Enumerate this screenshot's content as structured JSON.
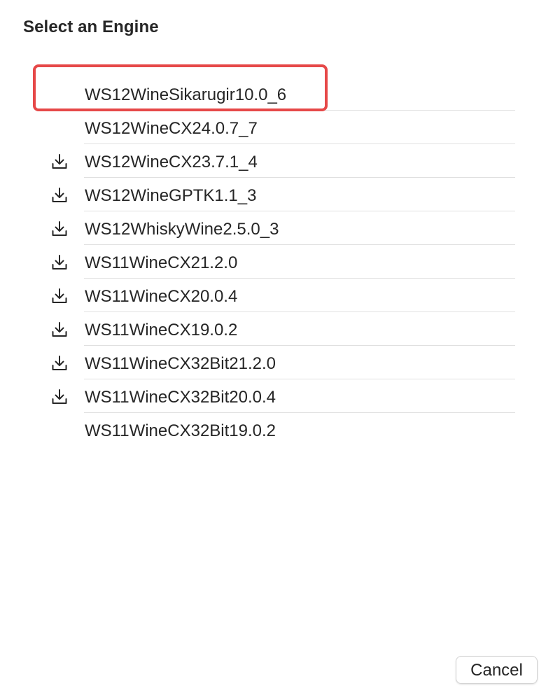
{
  "dialog": {
    "title": "Select an Engine"
  },
  "engines": [
    {
      "name": "WS12WineSikarugir10.0_6",
      "icon": "none"
    },
    {
      "name": "WS12WineCX24.0.7_7",
      "icon": "none"
    },
    {
      "name": "WS12WineCX23.7.1_4",
      "icon": "download-icon"
    },
    {
      "name": "WS12WineGPTK1.1_3",
      "icon": "download-icon"
    },
    {
      "name": "WS12WhiskyWine2.5.0_3",
      "icon": "download-icon"
    },
    {
      "name": "WS11WineCX21.2.0",
      "icon": "download-icon"
    },
    {
      "name": "WS11WineCX20.0.4",
      "icon": "download-icon"
    },
    {
      "name": "WS11WineCX19.0.2",
      "icon": "download-icon"
    },
    {
      "name": "WS11WineCX32Bit21.2.0",
      "icon": "download-icon"
    },
    {
      "name": "WS11WineCX32Bit20.0.4",
      "icon": "download-icon"
    },
    {
      "name": "WS11WineCX32Bit19.0.2",
      "icon": "none"
    }
  ],
  "buttons": {
    "cancel_label": "Cancel"
  },
  "colors": {
    "highlight_border": "#e64848",
    "text": "#262626",
    "divider": "#e0e0e0"
  }
}
